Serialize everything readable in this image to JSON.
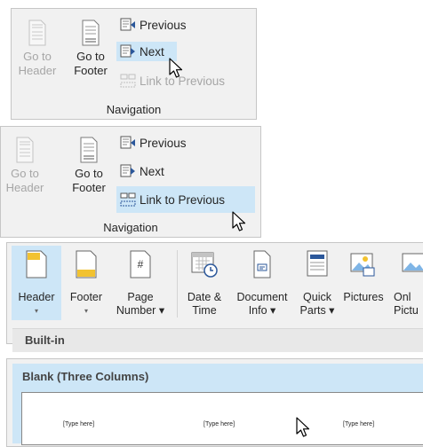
{
  "panel1": {
    "go_to_header": [
      "Go to",
      "Header"
    ],
    "go_to_footer": [
      "Go to",
      "Footer"
    ],
    "previous": "Previous",
    "next": "Next",
    "link_to_previous": "Link to Previous",
    "group": "Navigation"
  },
  "panel2": {
    "go_to_header": [
      "Go to",
      "Header"
    ],
    "go_to_footer": [
      "Go to",
      "Footer"
    ],
    "previous": "Previous",
    "next": "Next",
    "link_to_previous": "Link to Previous",
    "group": "Navigation"
  },
  "ribbon": {
    "buttons": [
      {
        "line1": "Header",
        "line2": "▾"
      },
      {
        "line1": "Footer",
        "line2": "▾"
      },
      {
        "line1": "Page",
        "line2": "Number ▾"
      },
      {
        "line1": "Date &",
        "line2": "Time"
      },
      {
        "line1": "Document",
        "line2": "Info ▾"
      },
      {
        "line1": "Quick",
        "line2": "Parts ▾"
      },
      {
        "line1": "Pictures",
        "line2": ""
      },
      {
        "line1": "Onl",
        "line2": "Pictu"
      }
    ],
    "section": "Built-in"
  },
  "gallery": {
    "title": "Blank (Three Columns)",
    "placeholders": [
      "[Type here]",
      "[Type here]",
      "[Type here]"
    ]
  },
  "colors": {
    "highlight": "#cde6f7",
    "accent": "#2b579a"
  }
}
